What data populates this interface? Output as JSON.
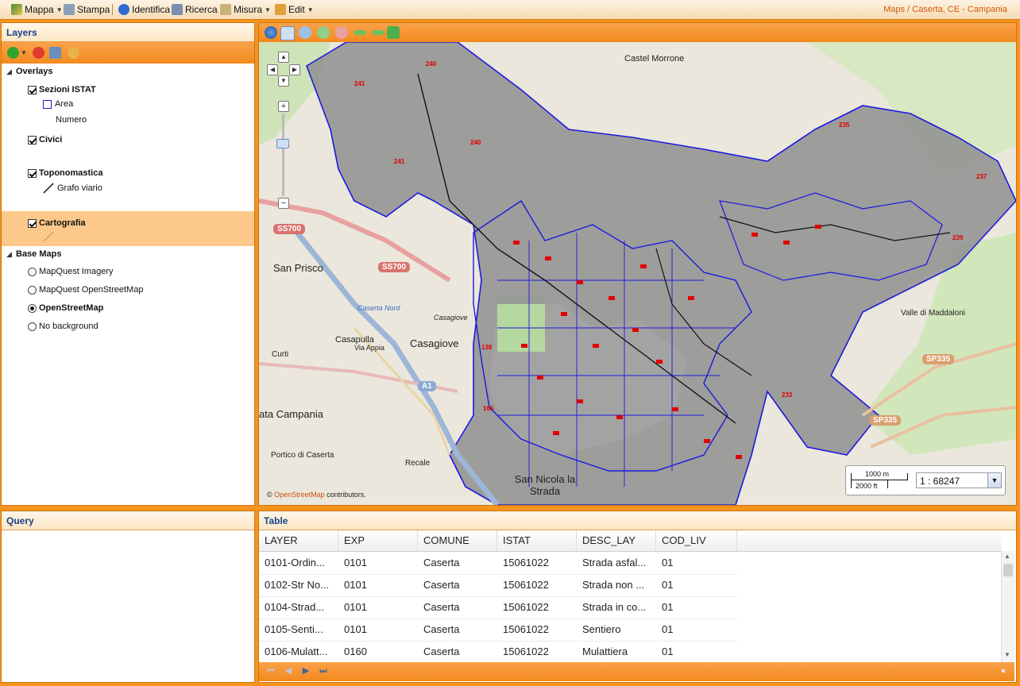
{
  "toolbar": {
    "mappa": "Mappa",
    "stampa": "Stampa",
    "identifica": "Identifica",
    "ricerca": "Ricerca",
    "misura": "Misura",
    "edit": "Edit"
  },
  "breadcrumb": {
    "root": "Maps",
    "separator": "/",
    "current": "Caserta, CE - Campania"
  },
  "layers_panel": {
    "title": "Layers",
    "overlays_label": "Overlays",
    "overlays": [
      {
        "label": "Sezioni ISTAT",
        "checked": true,
        "legend": [
          "Area",
          "Numero"
        ]
      },
      {
        "label": "Civici",
        "checked": true
      },
      {
        "label": "Toponomastica",
        "checked": true,
        "legend": [
          "Grafo viario"
        ]
      },
      {
        "label": "Cartografia",
        "checked": true,
        "selected": true
      }
    ],
    "basemaps_label": "Base Maps",
    "basemaps": [
      {
        "label": "MapQuest Imagery",
        "selected": false
      },
      {
        "label": "MapQuest OpenStreetMap",
        "selected": false
      },
      {
        "label": "OpenStreetMap",
        "selected": true
      },
      {
        "label": "No background",
        "selected": false
      }
    ]
  },
  "map": {
    "place_labels": [
      "Castel Morrone",
      "San Prisco",
      "Casagiove",
      "Casapulla",
      "Curti",
      "Recale",
      "Portico di Caserta",
      "San Nicola la Strada",
      "Valle di Maddaloni",
      "Casagiove",
      "Caserta Nord",
      "Via Appia",
      "ata Campania"
    ],
    "road_shields": [
      "SS700",
      "SS700",
      "A1",
      "SP335",
      "SP335"
    ],
    "scale_line_top": "1000 m",
    "scale_line_bottom": "2000 ft",
    "scale_value": "1 : 68247",
    "attribution_prefix": "©",
    "attribution_link": "OpenStreetMap",
    "attribution_suffix": "contributors.",
    "red_labels": [
      "240",
      "241",
      "240",
      "241",
      "235",
      "237",
      "239",
      "233",
      "138",
      "165"
    ]
  },
  "query_panel": {
    "title": "Query"
  },
  "table_panel": {
    "title": "Table",
    "columns": [
      "LAYER",
      "EXP",
      "COMUNE",
      "ISTAT",
      "DESC_LAY",
      "COD_LIV"
    ],
    "rows": [
      [
        "0101-Ordin...",
        "0101",
        "Caserta",
        "15061022",
        "Strada asfal...",
        "01"
      ],
      [
        "0102-Str No...",
        "0101",
        "Caserta",
        "15061022",
        "Strada non ...",
        "01"
      ],
      [
        "0104-Strad...",
        "0101",
        "Caserta",
        "15061022",
        "Strada in co...",
        "01"
      ],
      [
        "0105-Senti...",
        "0101",
        "Caserta",
        "15061022",
        "Sentiero",
        "01"
      ],
      [
        "0106-Mulatt...",
        "0160",
        "Caserta",
        "15061022",
        "Mulattiera",
        "01"
      ]
    ]
  },
  "colors": {
    "accent": "#f7941d",
    "title_text": "#15428b",
    "boundary": "#1a1ae0",
    "label_red": "#e00000"
  }
}
